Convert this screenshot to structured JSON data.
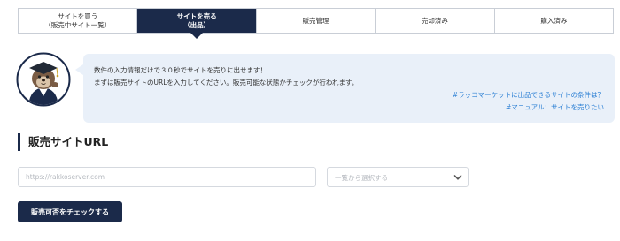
{
  "tabs": [
    {
      "line1": "サイトを買う",
      "line2": "（販売中サイト一覧）"
    },
    {
      "line1": "サイトを売る",
      "line2": "（出品）"
    },
    {
      "line1": "販売管理",
      "line2": ""
    },
    {
      "line1": "売却済み",
      "line2": ""
    },
    {
      "line1": "購入済み",
      "line2": ""
    }
  ],
  "info": {
    "line1": "数件の入力情報だけで３０秒でサイトを売りに出せます！",
    "line2": "まずは販売サイトのURLを入力してください。販売可能な状態かチェックが行われます。",
    "link1": "#ラッコマーケットに出品できるサイトの条件は？",
    "link2": "#マニュアル：サイトを売りたい"
  },
  "section": {
    "title": "販売サイトURL"
  },
  "form": {
    "url_placeholder": "https://rakkoserver.com",
    "select_placeholder": "一覧から選択する",
    "check_button": "販売可否をチェックする"
  },
  "colors": {
    "navy": "#1b2a4a",
    "link": "#2b7fd4",
    "info_bg": "#e9f0f9"
  }
}
